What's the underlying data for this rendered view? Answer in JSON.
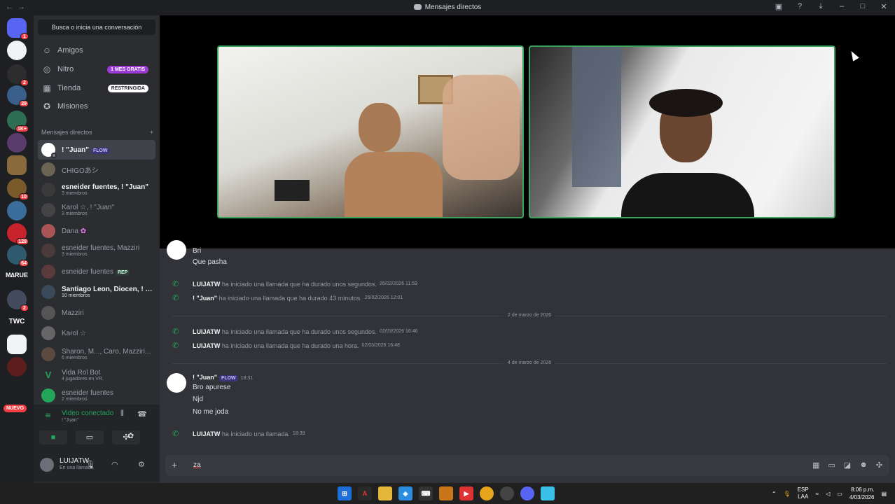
{
  "window": {
    "title": "Mensajes directos"
  },
  "servers": {
    "badges": [
      "1",
      "2",
      "29",
      "1K+",
      "10",
      "128",
      "64",
      "2"
    ],
    "twc_label": "TWC",
    "nuevo_label": "NUEVO"
  },
  "sidebar": {
    "search_label": "Busca o inicia una conversación",
    "nav": [
      {
        "label": "Amigos"
      },
      {
        "label": "Nitro",
        "tag": "1 MES GRATIS"
      },
      {
        "label": "Tienda",
        "tag": "RESTRINGIDA"
      },
      {
        "label": "Misiones"
      }
    ],
    "dm_header": "Mensajes directos",
    "dms": [
      {
        "name": "! \"Juan\"",
        "tag": "FLOW",
        "sub": ""
      },
      {
        "name": "CHIGOあシ",
        "sub": ""
      },
      {
        "name": "esneider fuentes, ! \"Juan\"",
        "sub": "3 miembros"
      },
      {
        "name": "Karol ☆, ! \"Juan\"",
        "sub": "3 miembros"
      },
      {
        "name": "Dana",
        "sub": ""
      },
      {
        "name": "esneider fuentes, Mazziri",
        "sub": "3 miembros"
      },
      {
        "name": "esneider fuentes",
        "tag": "REP",
        "sub": ""
      },
      {
        "name": "Santiago Leon, Diocen, ! \"...",
        "sub": "10 miembros"
      },
      {
        "name": "Mazziri",
        "sub": ""
      },
      {
        "name": "Karol ☆",
        "sub": ""
      },
      {
        "name": "Sharon, M..., Caro, Mazziri...",
        "sub": "6 miembros"
      },
      {
        "name": "Vida Rol Bot",
        "sub": "4 jugadores en VR."
      },
      {
        "name": "esneider fuentes",
        "sub": "2 miembros"
      }
    ]
  },
  "voice": {
    "status": "Video conectado",
    "channel": "! \"Juan\""
  },
  "user": {
    "name": "LUIJATW",
    "status": "En una llamada"
  },
  "chat": {
    "prev_line1": "Bri",
    "prev_line2": "Que pasha",
    "call1_who": "LUIJATW",
    "call1_text": "ha iniciado una llamada que ha durado unos segundos.",
    "call1_ts": "26/02/2026 11:59",
    "call2_who": "! \"Juan\"",
    "call2_text": "ha iniciado una llamada que ha durado 43 minutos.",
    "call2_ts": "26/02/2026 12:01",
    "date1": "2 de marzo de 2026",
    "call3_who": "LUIJATW",
    "call3_text": "ha iniciado una llamada que ha durado unos segundos.",
    "call3_ts": "02/03/2026 16:46",
    "call4_who": "LUIJATW",
    "call4_text": "ha iniciado una llamada que ha durado una hora.",
    "call4_ts": "02/03/2026 16:48",
    "date2": "4 de marzo de 2026",
    "author": "! \"Juan\"",
    "author_tag": "FLOW",
    "author_ts": "18:31",
    "line1": "Bro apurese",
    "line2": "Njd",
    "line3": "No me joda",
    "call5_who": "LUIJATW",
    "call5_text": "ha iniciado una llamada.",
    "call5_ts": "18:39"
  },
  "input": {
    "value": "za"
  },
  "taskbar": {
    "lang1": "ESP",
    "lang2": "LAA",
    "time": "8:06 p.m.",
    "date": "4/03/2026"
  },
  "colors": {
    "accent": "#5865f2",
    "online": "#23a55a",
    "call_border": "#3ba55d",
    "danger": "#f23f43"
  }
}
